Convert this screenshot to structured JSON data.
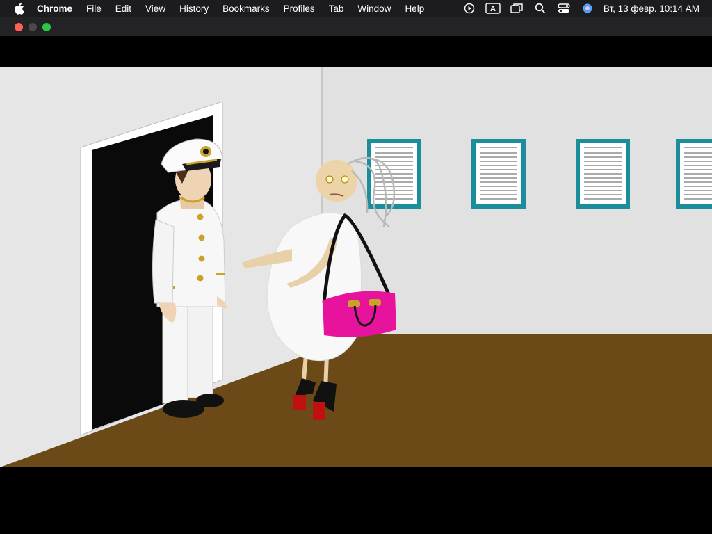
{
  "menubar": {
    "app_name": "Chrome",
    "items": [
      "File",
      "Edit",
      "View",
      "History",
      "Bookmarks",
      "Profiles",
      "Tab",
      "Window",
      "Help"
    ],
    "keyboard_layout": "A",
    "clock": "Вт, 13 февр.  10:14 AM"
  },
  "window": {
    "traffic_lights": {
      "close": "#ff5f57",
      "minimize": "#4a4a4c",
      "zoom": "#28c840"
    }
  },
  "scene": {
    "colors": {
      "wall": "#e4e4e4",
      "floor": "#6b4a17",
      "poster_frame": "#1a8e9a",
      "bag": "#e8139c",
      "shoes": "#c11010"
    }
  }
}
